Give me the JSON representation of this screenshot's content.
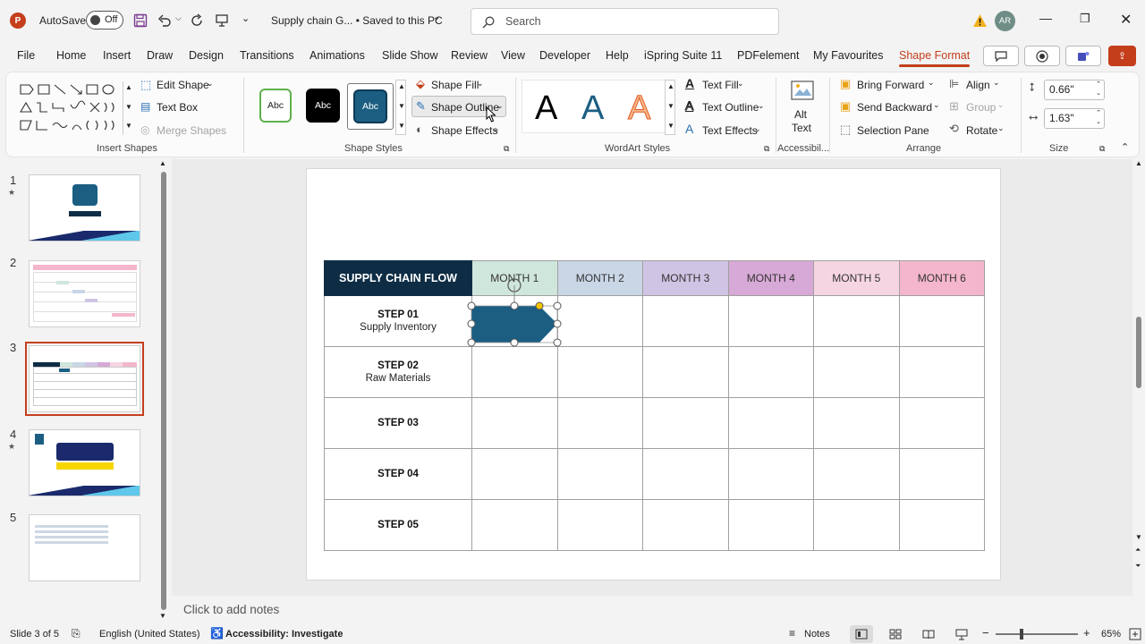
{
  "titlebar": {
    "autosave_label": "AutoSave",
    "autosave_state": "Off",
    "doc_title": "Supply chain G... • Saved to this PC",
    "search_placeholder": "Search",
    "user_initials": "AR"
  },
  "menu": {
    "tabs": [
      "File",
      "Home",
      "Insert",
      "Draw",
      "Design",
      "Transitions",
      "Animations",
      "Slide Show",
      "Review",
      "View",
      "Developer",
      "Help",
      "iSpring Suite 11",
      "PDFelement",
      "My Favourites",
      "Shape Format"
    ],
    "active_tab": "Shape Format"
  },
  "ribbon": {
    "insert_shapes": {
      "label": "Insert Shapes",
      "edit_shape": "Edit Shape",
      "text_box": "Text Box",
      "merge_shapes": "Merge Shapes"
    },
    "shape_styles": {
      "label": "Shape Styles",
      "presets": [
        "Abc",
        "Abc",
        "Abc"
      ],
      "shape_fill": "Shape Fill",
      "shape_outline": "Shape Outline",
      "shape_effects": "Shape Effects"
    },
    "wordart_styles": {
      "label": "WordArt Styles",
      "letters": [
        "A",
        "A",
        "A"
      ],
      "text_fill": "Text Fill",
      "text_outline": "Text Outline",
      "text_effects": "Text Effects"
    },
    "accessibility": {
      "label": "Accessibil...",
      "alt_text_line1": "Alt",
      "alt_text_line2": "Text"
    },
    "arrange": {
      "label": "Arrange",
      "bring_forward": "Bring Forward",
      "send_backward": "Send Backward",
      "selection_pane": "Selection Pane",
      "align": "Align",
      "group": "Group",
      "rotate": "Rotate"
    },
    "size": {
      "label": "Size",
      "height": "0.66\"",
      "width": "1.63\""
    }
  },
  "thumbnails": [
    {
      "number": "1",
      "star": true
    },
    {
      "number": "2",
      "star": false
    },
    {
      "number": "3",
      "star": false,
      "selected": true
    },
    {
      "number": "4",
      "star": true
    },
    {
      "number": "5",
      "star": false
    }
  ],
  "slide": {
    "table": {
      "corner_header": "SUPPLY CHAIN FLOW",
      "months": [
        "MONTH 1",
        "MONTH 2",
        "MONTH 3",
        "MONTH 4",
        "MONTH 5",
        "MONTH 6"
      ],
      "month_colors": [
        "#cfe6dc",
        "#c9d6e6",
        "#d0c4e4",
        "#d7a9d6",
        "#f6d5e3",
        "#f4b6cc"
      ],
      "corner_color": "#0e2d45",
      "steps": [
        {
          "title": "STEP 01",
          "subtitle": "Supply Inventory"
        },
        {
          "title": "STEP 02",
          "subtitle": "Raw Materials"
        },
        {
          "title": "STEP 03",
          "subtitle": ""
        },
        {
          "title": "STEP 04",
          "subtitle": ""
        },
        {
          "title": "STEP 05",
          "subtitle": ""
        }
      ]
    },
    "selected_shape_color": "#1b5e82"
  },
  "notes_placeholder": "Click to add notes",
  "status": {
    "slide_info": "Slide 3 of 5",
    "language": "English (United States)",
    "accessibility": "Accessibility: Investigate",
    "notes": "Notes",
    "zoom": "65%"
  }
}
